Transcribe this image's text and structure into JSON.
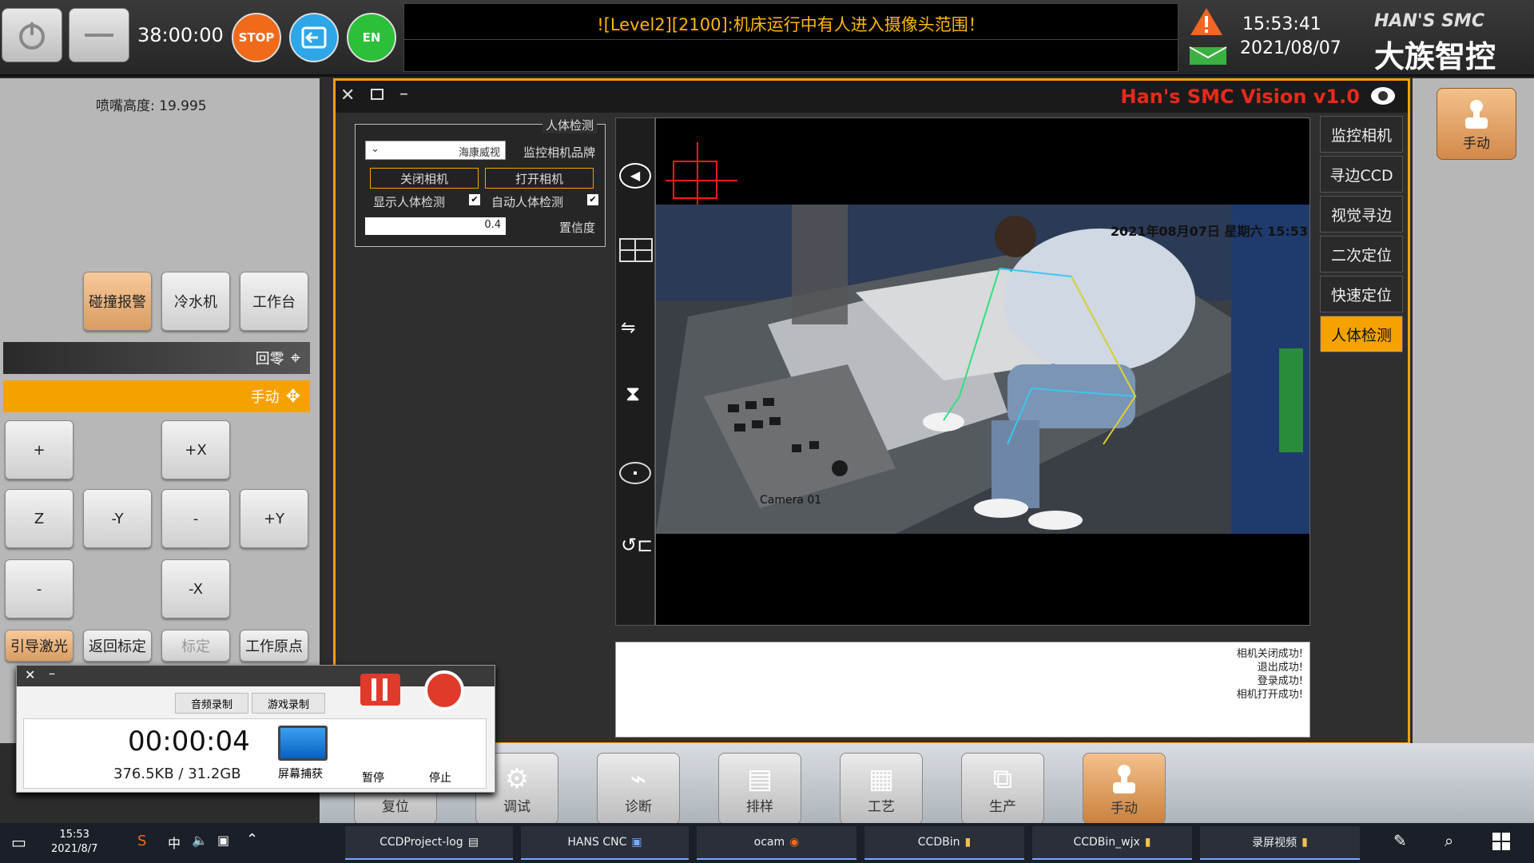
{
  "topbar": {
    "timer": "38:00:00",
    "stop_label": "STOP",
    "en_label": "EN",
    "alarm_message": "!机床运行中有人进入摄像头范围！[Level2][2100]:机床运行中有人进入摄像头范围!",
    "alarm_message_display": "![Level2][2100]:机床运行中有人进入摄像头范围！",
    "clock_time": "15:53:41",
    "clock_date": "2021/08/07",
    "brand_en": "HAN'S SMC",
    "brand_cn": "大族智控"
  },
  "leftpanel": {
    "nozzle_height": "喷嘴高度: 19.995",
    "row1": [
      "工作台",
      "冷水机",
      "碰撞报警"
    ],
    "home_label": "回零",
    "manual_label": "手动",
    "jog": {
      "plus": "+",
      "plus_x": "+X",
      "z": "Z",
      "minus_y": "-Y",
      "minus": "-",
      "plus_y": "+Y",
      "minus2": "-",
      "minus_x": "-X"
    },
    "row_bottom": [
      "工作原点",
      "标定",
      "返回标定",
      "引导激光"
    ]
  },
  "vision": {
    "title": "Han's SMC Vision v1.0",
    "nav": [
      "监控相机",
      "寻边CCD",
      "视觉寻边",
      "二次定位",
      "快速定位",
      "人体检测"
    ],
    "active_nav": 5,
    "group_title": "人体检测",
    "brand_label": "监控相机品牌",
    "brand_value": "海康威视",
    "open_camera": "打开相机",
    "close_camera": "关闭相机",
    "auto_detect": "自动人体检测",
    "show_detect": "显示人体检测",
    "confidence_label": "置信度",
    "confidence_value": "0.4",
    "osd_datetime": "2021年08月07日 星期六 15:53",
    "osd_camera": "Camera 01",
    "log": [
      "相机打开成功!",
      "登录成功!",
      "退出成功!",
      "相机关闭成功!"
    ]
  },
  "recorder": {
    "tabs": [
      "游戏录制",
      "音频录制"
    ],
    "elapsed": "00:00:04",
    "size": "376.5KB / 31.2GB",
    "screen_label": "屏幕捕获",
    "pause_label": "暂停",
    "stop_label": "停止"
  },
  "appbar": {
    "buttons": [
      "手动",
      "生产",
      "工艺",
      "排样",
      "诊断",
      "调试",
      "复位"
    ]
  },
  "taskbar": {
    "items": [
      "录屏视频",
      "CCDBin_wjx",
      "CCDBin",
      "ocam",
      "HANS CNC",
      "CCDProject-log"
    ],
    "tray_time": "15:53",
    "tray_date": "2021/8/7",
    "ime": "中"
  },
  "colors": {
    "accent": "#f5a200",
    "alarm_text": "#ffb700",
    "title_red": "#e8291c"
  }
}
